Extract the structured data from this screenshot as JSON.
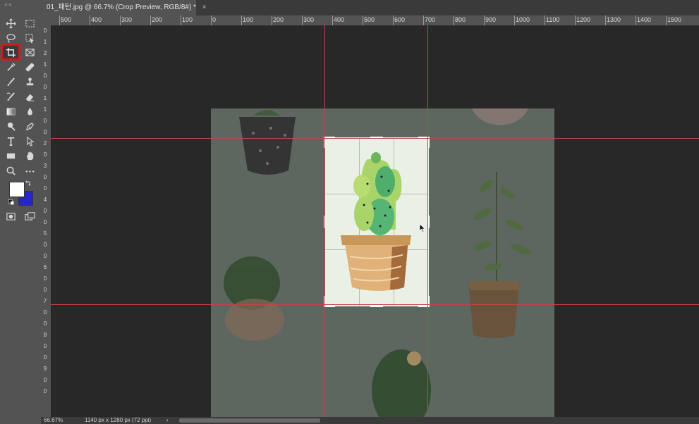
{
  "tab": {
    "title": "01_패턴.jpg @ 66.7% (Crop Preview, RGB/8#) *",
    "close": "×"
  },
  "toolbar": {
    "grip": "««"
  },
  "ruler": {
    "top_labels": [
      "500",
      "400",
      "300",
      "200",
      "100",
      "0",
      "100",
      "200",
      "300",
      "400",
      "500",
      "600",
      "700",
      "800",
      "900",
      "1000",
      "1100",
      "1200",
      "1300",
      "1400",
      "1500"
    ],
    "left_labels": [
      "0",
      "1",
      "2",
      "1",
      "0",
      "0",
      "1",
      "1",
      "0",
      "0",
      "2",
      "0",
      "3",
      "0",
      "0",
      "4",
      "0",
      "0",
      "5",
      "0",
      "0",
      "6",
      "0",
      "0",
      "7",
      "0",
      "0",
      "8",
      "0",
      "0",
      "9",
      "0",
      "0"
    ]
  },
  "status": {
    "zoom": "66.67%",
    "info": "1140 px x 1280 px (72 ppi)",
    "arrow": "›"
  },
  "colors": {
    "foreground": "#ffffff",
    "background": "#2525c8",
    "guide": "#c84343",
    "active_tool_outline": "#d11a1a"
  }
}
